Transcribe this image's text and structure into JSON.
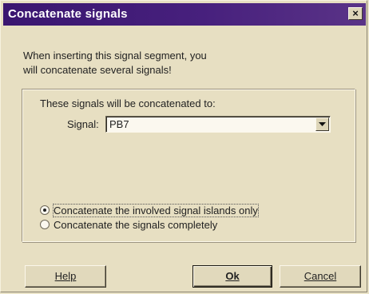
{
  "window": {
    "title": "Concatenate signals",
    "close_glyph": "×"
  },
  "intro": {
    "line1": "When inserting this signal segment, you",
    "line2": "will concatenate several signals!"
  },
  "group": {
    "title": "These signals will be concatenated to:",
    "signal_label": "Signal:",
    "signal_value": "PB7"
  },
  "options": [
    {
      "label": "Concatenate the involved signal islands only",
      "selected": true
    },
    {
      "label": "Concatenate the signals completely",
      "selected": false
    }
  ],
  "buttons": {
    "help": "Help",
    "ok": "Ok",
    "cancel": "Cancel"
  },
  "colors": {
    "titlebar": "#47207d",
    "face": "#e7dfc2"
  },
  "icons": {
    "close": "close-icon",
    "dropdown": "chevron-down-icon"
  }
}
